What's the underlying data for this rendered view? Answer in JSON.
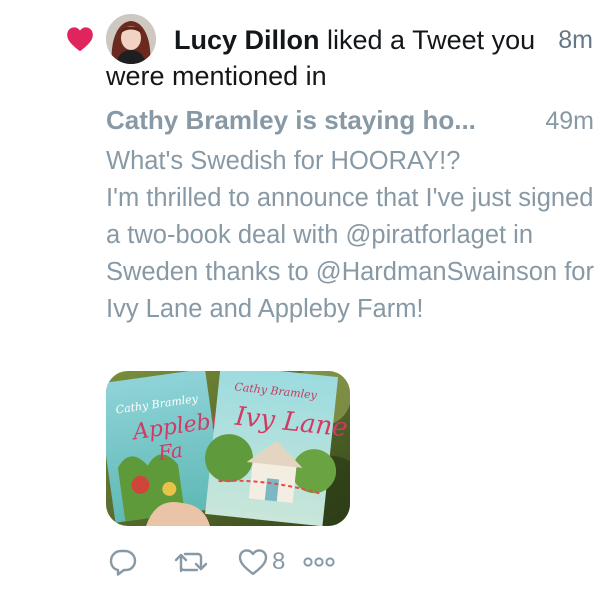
{
  "notification": {
    "actor": "Lucy Dillon",
    "action_text": " liked a Tweet you were mentioned in",
    "time": "8m"
  },
  "quoted_tweet": {
    "author": "Cathy Bramley is staying ho...",
    "time": "49m",
    "text": "What's Swedish for HOORAY!?\nI'm thrilled to announce that I've just signed a two-book deal with @piratforlaget in Sweden thanks to @HardmanSwainson for Ivy Lane and Appleby Farm!",
    "media": {
      "book_left_author": "Cathy Bramley",
      "book_left_title": "Appleby Farm",
      "book_right_author": "Cathy Bramley",
      "book_right_title": "Ivy Lane"
    }
  },
  "actions": {
    "reply_icon": "reply-icon",
    "retweet_icon": "retweet-icon",
    "like_icon": "heart-outline-icon",
    "like_count": "8",
    "more_icon": "more-dots-icon"
  },
  "colors": {
    "like_red": "#e0245e",
    "text_dark": "#14171a",
    "text_muted": "#8899a6"
  }
}
